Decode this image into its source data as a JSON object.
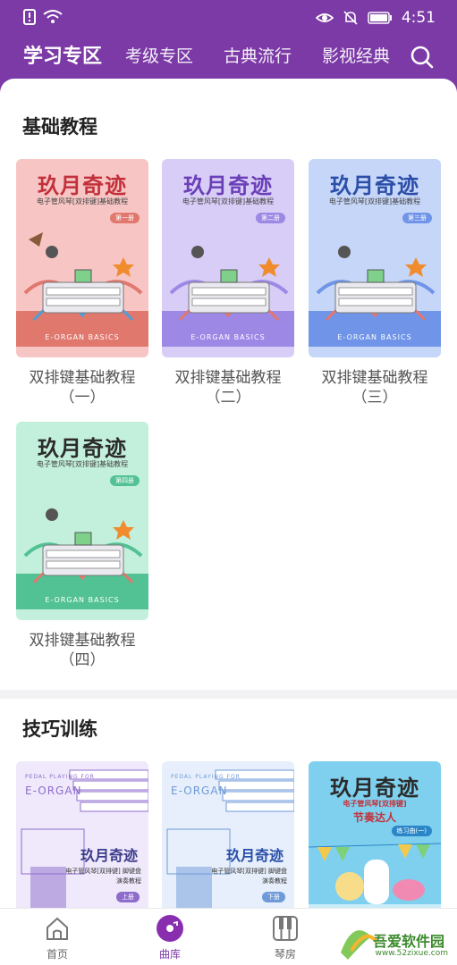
{
  "status_bar": {
    "time": "4:51"
  },
  "tabs": [
    "学习专区",
    "考级专区",
    "古典流行",
    "影视经典"
  ],
  "sections": [
    {
      "title": "基础教程",
      "cards": [
        {
          "cover_title": "玖月奇迹",
          "cover_sub": "电子管风琴[双排键]基础教程",
          "badge": "第一册",
          "foot": "E-ORGAN BASICS",
          "label_line1": "双排键基础教程",
          "label_line2": "（一）",
          "bg": "#f7c6c4",
          "accent": "#e0786e",
          "title_color": "#c2313b"
        },
        {
          "cover_title": "玖月奇迹",
          "cover_sub": "电子管风琴[双排键]基础教程",
          "badge": "第二册",
          "foot": "E-ORGAN BASICS",
          "label_line1": "双排键基础教程",
          "label_line2": "（二）",
          "bg": "#d8cdf6",
          "accent": "#9d88e6",
          "title_color": "#6a3fb8"
        },
        {
          "cover_title": "玖月奇迹",
          "cover_sub": "电子管风琴[双排键]基础教程",
          "badge": "第三册",
          "foot": "E-ORGAN BASICS",
          "label_line1": "双排键基础教程",
          "label_line2": "（三）",
          "bg": "#c6d6f8",
          "accent": "#6f94e8",
          "title_color": "#2b4ea8"
        },
        {
          "cover_title": "玖月奇迹",
          "cover_sub": "电子管风琴[双排键]基础教程",
          "badge": "第四册",
          "foot": "E-ORGAN BASICS",
          "label_line1": "双排键基础教程",
          "label_line2": "（四）",
          "bg": "#c3f0dc",
          "accent": "#52c294",
          "title_color": "#2b2b2b"
        }
      ]
    },
    {
      "title": "技巧训练",
      "cards": [
        {
          "pedal": "PEDAL PLAYING FOR",
          "pedal_title": "E-ORGAN",
          "cover_title": "玖月奇迹",
          "cover_sub": "电子管风琴[双排键] 脚键盘演奏教程",
          "badge": "上册",
          "bg": "#efe9fb",
          "accent": "#8d6ccc"
        },
        {
          "pedal": "PEDAL PLAYING FOR",
          "pedal_title": "E-ORGAN",
          "cover_title": "玖月奇迹",
          "cover_sub": "电子管风琴[双排键] 脚键盘演奏教程",
          "badge": "下册",
          "bg": "#e6effb",
          "accent": "#6f9ad8"
        },
        {
          "cover_title": "玖月奇迹",
          "cover_sub": "电子管风琴[双排键]",
          "sub2": "节奏达人",
          "badge": "练习曲(一)",
          "bg": "#7fd0ef",
          "accent": "#2b86c8"
        }
      ]
    }
  ],
  "bottom_nav": [
    {
      "label": "首页",
      "icon": "home-icon"
    },
    {
      "label": "曲库",
      "icon": "disc-icon"
    },
    {
      "label": "琴房",
      "icon": "piano-icon"
    }
  ],
  "watermark": {
    "name": "吾爱软件园",
    "url": "www.52zixue.com"
  }
}
